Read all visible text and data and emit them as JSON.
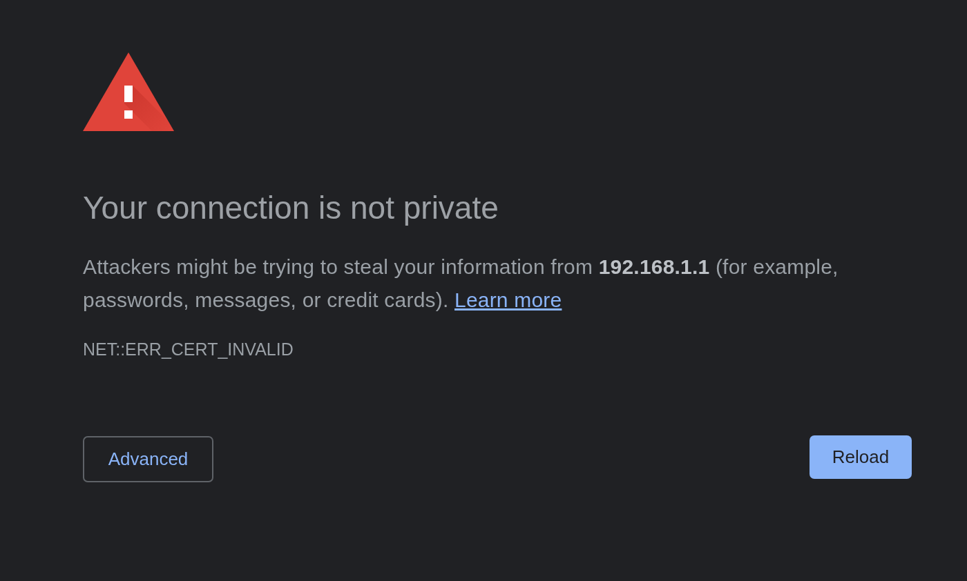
{
  "heading": "Your connection is not private",
  "message": {
    "text": "Attackers might be trying to steal your information from **192.168.1.1** (for example, passwords, messages, or credit cards).",
    "link": "Learn more"
  },
  "error_code": "NET::ERR_CERT_INVALID",
  "buttons": [
    {
      "label": "Advanced",
      "kind": "secondary"
    },
    {
      "label": "Reload",
      "kind": "primary"
    }
  ]
}
